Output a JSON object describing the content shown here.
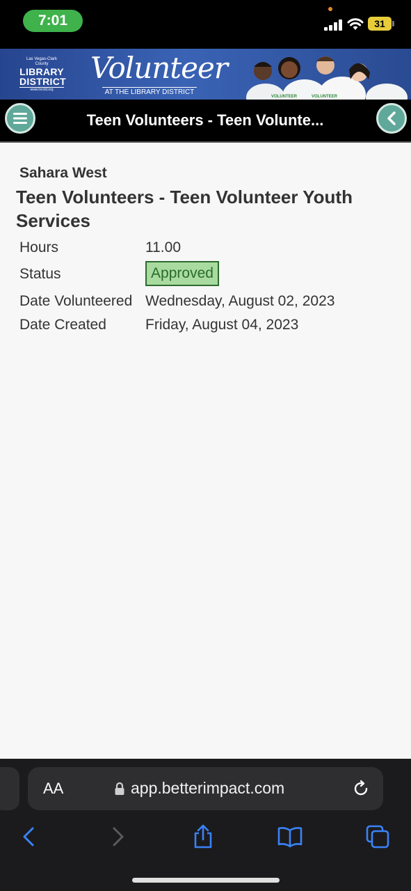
{
  "status_bar": {
    "time": "7:01",
    "battery": "31"
  },
  "banner": {
    "library_small": "Las Vegas-Clark County",
    "library_line1": "LIBRARY",
    "library_line2": "DISTRICT",
    "library_url": "www.lvccld.org",
    "volunteer_title": "Volunteer",
    "volunteer_subtitle": "AT THE LIBRARY DISTRICT",
    "shirt_text": "VOLUNTEER"
  },
  "header": {
    "title": "Teen Volunteers - Teen Volunte..."
  },
  "record": {
    "location": "Sahara West",
    "title": "Teen Volunteers - Teen Volunteer Youth Services",
    "hours_label": "Hours",
    "hours_value": "11.00",
    "status_label": "Status",
    "status_value": "Approved",
    "date_volunteered_label": "Date Volunteered",
    "date_volunteered_value": "Wednesday, August 02, 2023",
    "date_created_label": "Date Created",
    "date_created_value": "Friday, August 04, 2023"
  },
  "browser": {
    "text_size_label": "AA",
    "url": "app.betterimpact.com"
  },
  "colors": {
    "header_bg": "#000000",
    "nav_button": "#5fa89a",
    "status_approved_bg": "#a9dba0",
    "status_approved_border": "#2d6a2d",
    "time_pill": "#3fb24b",
    "browser_accent": "#3a82f7"
  }
}
